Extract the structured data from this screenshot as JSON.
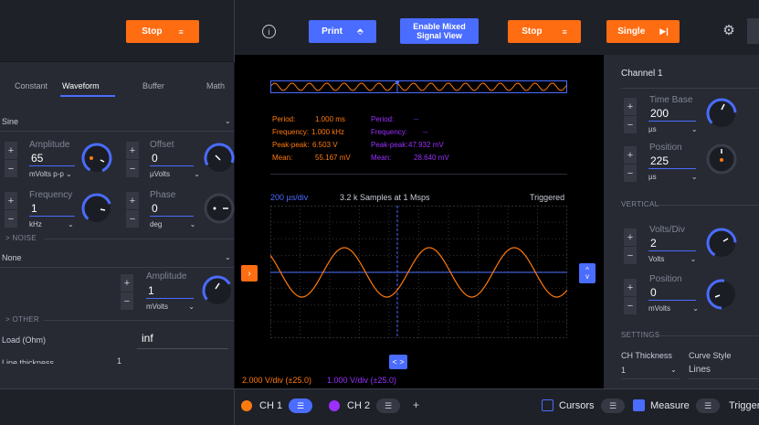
{
  "left": {
    "stop_label": "Stop",
    "tabs": [
      "Constant",
      "Waveform",
      "Buffer",
      "Math"
    ],
    "waveform_type": "Sine",
    "amplitude": {
      "label": "Amplitude",
      "value": "65",
      "unit": "mVolts p-p"
    },
    "offset": {
      "label": "Offset",
      "value": "0",
      "unit": "µVolts"
    },
    "frequency": {
      "label": "Frequency",
      "value": "1",
      "unit": "kHz"
    },
    "phase": {
      "label": "Phase",
      "value": "0",
      "unit": "deg"
    },
    "noise_section": "NOISE",
    "noise_type": "None",
    "noise_amplitude": {
      "label": "Amplitude",
      "value": "1",
      "unit": "mVolts"
    },
    "other_section": "OTHER",
    "load_label": "Load (Ohm)",
    "load_value": "inf",
    "line_thickness_label": "Line thickness",
    "line_thickness_value": "1"
  },
  "toolbar": {
    "info_icon": "info-icon",
    "print_label": "Print",
    "mixed_label_1": "Enable Mixed",
    "mixed_label_2": "Signal View",
    "stop_label": "Stop",
    "single_label": "Single",
    "settings_icon": "gear-icon"
  },
  "scope": {
    "ch1": {
      "period_label": "Period:",
      "period": "1.000 ms",
      "freq_label": "Frequency:",
      "freq": "1.000 kHz",
      "pp_label": "Peak-peak:",
      "pp": "6.503 V",
      "mean_label": "Mean:",
      "mean": "55.167 mV"
    },
    "ch2": {
      "period_label": "Period:",
      "period": "--",
      "freq_label": "Frequency:",
      "freq": "--",
      "pp_label": "Peak-peak:",
      "pp": "47.932 mV",
      "mean_label": "Mean:",
      "mean": "28.640 mV"
    },
    "timebase": "200 µs/div",
    "samples": "3.2 k Samples at 1 Msps",
    "status": "Triggered",
    "ch1_scale": "2.000 V/div (±25.0)",
    "ch2_scale": "1.000 V/div (±25.0)"
  },
  "right": {
    "channel": "Channel 1",
    "time_base": {
      "label": "Time Base",
      "value": "200",
      "unit": "µs"
    },
    "position": {
      "label": "Position",
      "value": "225",
      "unit": "µs"
    },
    "vertical_section": "VERTICAL",
    "volts_div": {
      "label": "Volts/Div",
      "value": "2",
      "unit": "Volts"
    },
    "v_position": {
      "label": "Position",
      "value": "0",
      "unit": "mVolts"
    },
    "settings_section": "SETTINGS",
    "ch_thickness_label": "CH Thickness",
    "ch_thickness_value": "1",
    "curve_style_label": "Curve Style",
    "curve_style_value": "Lines"
  },
  "bottom": {
    "ch1_label": "CH 1",
    "ch2_label": "CH 2",
    "add_label": "+",
    "cursors_label": "Cursors",
    "measure_label": "Measure",
    "trigger_label": "Trigger"
  },
  "colors": {
    "accent_blue": "#4a6cff",
    "stop_orange": "#ff6d12",
    "ch1_orange": "#ff7a0e",
    "ch2_purple": "#9b30ff"
  }
}
